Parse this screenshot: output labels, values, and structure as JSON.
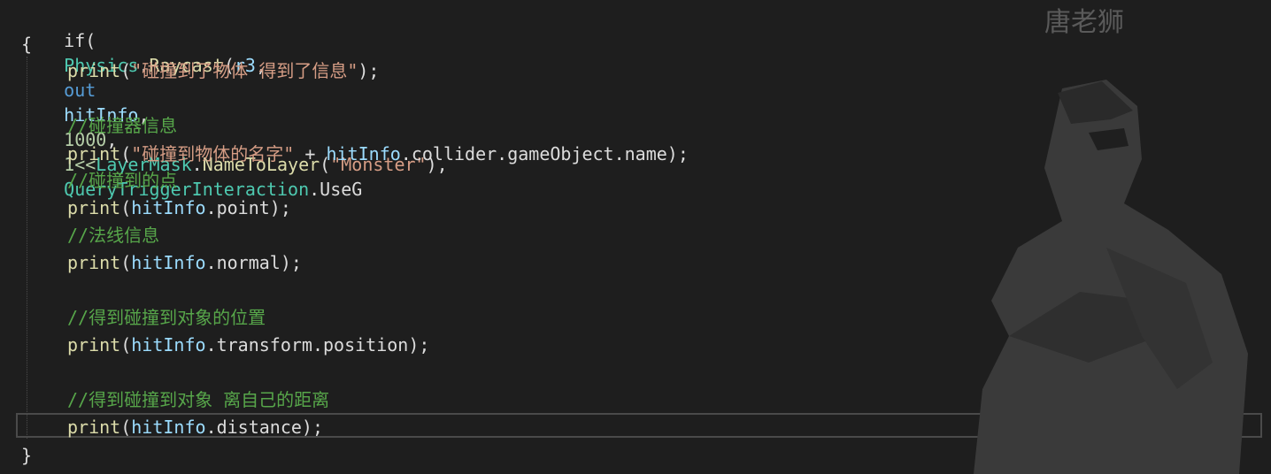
{
  "watermark": "唐老狮",
  "code": {
    "l1": {
      "kw_if": "if(",
      "cls": "Physics",
      "dot": ".",
      "method": "Raycast",
      "open": "(",
      "arg1": "r3",
      "comma1": ",",
      "kw_out": "out",
      "arg2": "hitInfo",
      "comma2": ",",
      "num1": "1000",
      "comma3": ",",
      "num2": "1<<",
      "cls2": "LayerMask",
      "dot2": ".",
      "method2": "NameToLayer",
      "open2": "(",
      "str1": "\"Monster\"",
      "close2": "),",
      "cls3": "QueryTriggerInteraction",
      "dot3": ".",
      "enum": "UseG"
    },
    "l2": "{",
    "l3": {
      "fn": "print",
      "open": "(",
      "str": "\"碰撞到了物体 得到了信息\"",
      "close": ");"
    },
    "l5": "//碰撞器信息",
    "l6": {
      "fn": "print",
      "open": "(",
      "str": "\"碰撞到物体的名字\"",
      "plus": " + ",
      "var": "hitInfo",
      "rest": ".collider.gameObject.name);"
    },
    "l7": "//碰撞到的点",
    "l8": {
      "fn": "print",
      "open": "(",
      "var": "hitInfo",
      "rest": ".point);"
    },
    "l9": "//法线信息",
    "l10": {
      "fn": "print",
      "open": "(",
      "var": "hitInfo",
      "rest": ".normal);"
    },
    "l12": "//得到碰撞到对象的位置",
    "l13": {
      "fn": "print",
      "open": "(",
      "var": "hitInfo",
      "rest": ".transform.position);"
    },
    "l15": "//得到碰撞到对象 离自己的距离",
    "l16": {
      "fn": "print",
      "open": "(",
      "var": "hitInfo",
      "rest": ".distance);"
    },
    "l17": "}"
  }
}
